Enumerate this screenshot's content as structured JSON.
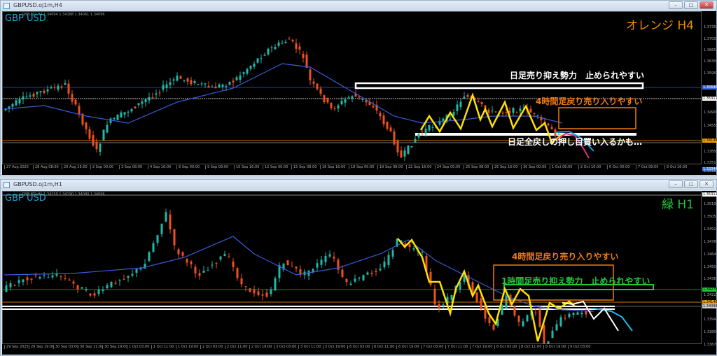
{
  "windows": [
    {
      "title": "GBPUSD.oj1m,H4",
      "symbol": "GBP USD",
      "ohlc": "GBPUSD,H4  1.34094 1.34188 1.34061 1.34096",
      "tag": "オレンジ H4",
      "tag_color": "#f08c00",
      "notes": [
        {
          "text": "日足売り抑え勢力　止められやすい",
          "color": "#ffffff"
        },
        {
          "text": "4時間足戻り売り入りやすい",
          "color": "#f07a10"
        },
        {
          "text": "日足全戻しの押し目買い入るかも…",
          "color": "#ffffff"
        }
      ],
      "price_labels": [
        "1.37350",
        "1.37000",
        "1.36650",
        "1.36300",
        "1.35950",
        "1.35646",
        "1.35311",
        "1.34900",
        "1.34550",
        "1.34146",
        "1.33850",
        "1.33510",
        "1.33344",
        "1.33160"
      ],
      "time_labels": [
        "27 Aug 2025",
        "28 Aug 08:00",
        "29 Aug 16:00",
        "2 Sep 00:00",
        "3 Sep 08:00",
        "4 Sep 16:00",
        "8 Sep 00:00",
        "9 Sep 08:00",
        "10 Sep 16:00",
        "12 Sep 00:00",
        "15 Sep 08:00",
        "16 Sep 16:00",
        "18 Sep 00:00",
        "19 Sep 08:00",
        "22 Sep 16:00",
        "24 Sep 00:00",
        "25 Sep 08:00",
        "26 Sep 16:00",
        "30 Sep 00:00",
        "1 Oct 08:00",
        "2 Oct 16:00",
        "6 Oct 00:00",
        "7 Oct 08:00",
        "8 Oct 16:00"
      ]
    },
    {
      "title": "GBPUSD.oj1m,H1",
      "symbol": "GBP USD",
      "ohlc": "GBPUSD,H1  1.34159 1.34190 1.34080 1.34096",
      "tag": "緑 H1",
      "tag_color": "#22c83a",
      "notes": [
        {
          "text": "4時間足戻り売り入りやすい",
          "color": "#f07a10"
        },
        {
          "text": "1時間足売り抑え勢力　止められやすい",
          "color": "#22c83a"
        }
      ],
      "price_labels": [
        "1.35311",
        "1.35190",
        "1.35050",
        "1.34915",
        "1.34780",
        "1.34645",
        "1.34505",
        "1.34365",
        "1.34276",
        "1.34225",
        "1.34146",
        "1.34096",
        "1.33945",
        "1.33805",
        "1.33670"
      ],
      "time_labels": [
        "29 Sep 2025",
        "29 Sep 19:00",
        "30 Sep 03:00",
        "30 Sep 11:00",
        "30 Sep 19:00",
        "1 Oct 03:00",
        "1 Oct 11:00",
        "1 Oct 19:00",
        "2 Oct 03:00",
        "2 Oct 11:00",
        "2 Oct 19:00",
        "3 Oct 03:00",
        "3 Oct 11:00",
        "3 Oct 19:00",
        "6 Oct 03:00",
        "6 Oct 11:00",
        "6 Oct 19:00",
        "7 Oct 03:00",
        "7 Oct 11:00",
        "7 Oct 19:00",
        "8 Oct 03:00",
        "8 Oct 11:00",
        "8 Oct 19:00",
        "9 Oct 03:00"
      ]
    }
  ],
  "window_buttons": {
    "minimize": "–",
    "maximize": "□",
    "close": "✕"
  }
}
